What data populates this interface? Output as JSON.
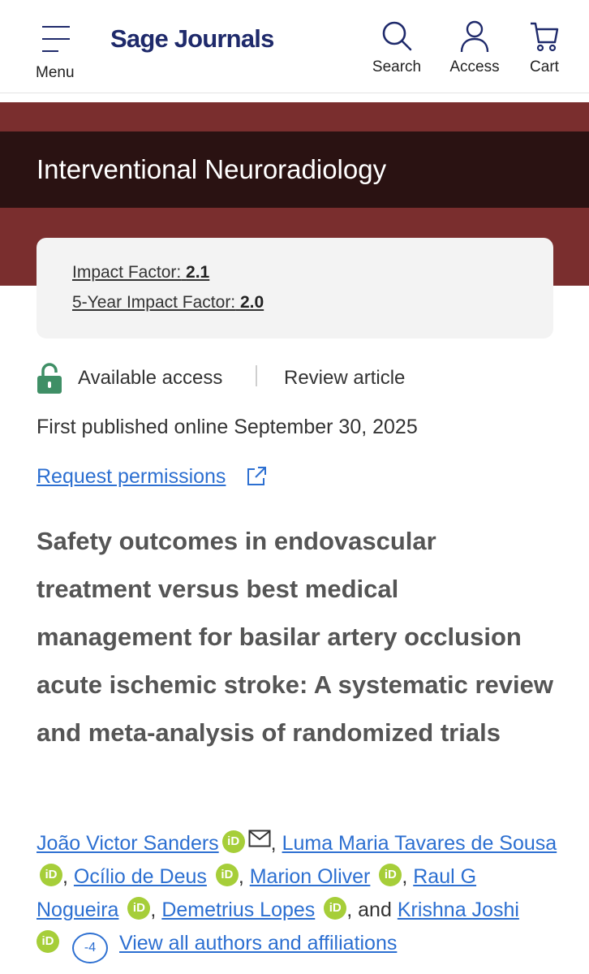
{
  "header": {
    "menu_label": "Menu",
    "logo": "Sage Journals",
    "search_label": "Search",
    "access_label": "Access",
    "cart_label": "Cart"
  },
  "journal": {
    "title": "Interventional Neuroradiology",
    "impact_factor_label": "Impact Factor:",
    "impact_factor_value": "2.1",
    "five_year_label": "5-Year Impact Factor:",
    "five_year_value": "2.0"
  },
  "article": {
    "access_type": "Available access",
    "article_type": "Review article",
    "published": "First published online September 30, 2025",
    "permissions_link": "Request permissions",
    "title": "Safety outcomes in endovascular treatment versus best medical management for basilar artery occlusion acute ischemic stroke: A systematic review and meta-analysis of randomized trials"
  },
  "authors": {
    "list": [
      "João Victor Sanders",
      "Luma Maria Tavares de Sousa",
      "Ocílio de Deus",
      "Marion Oliver",
      "Raul G Nogueira",
      "Demetrius Lopes",
      "Krishna Joshi"
    ],
    "orcid_glyph": "iD",
    "conjunction": "and",
    "hidden_count": "-4",
    "view_all_label": "View all authors and affiliations"
  },
  "colors": {
    "brand_navy": "#1f2a6b",
    "journal_maroon": "#7a2e2e",
    "journal_dark": "#2a1212",
    "link_blue": "#2c6fd1",
    "orcid_green": "#a6ce39",
    "lock_green": "#3f8f66"
  },
  "icons": [
    "menu-icon",
    "search-icon",
    "user-icon",
    "cart-icon",
    "lock-icon",
    "external-link-icon",
    "mail-icon",
    "orcid-icon"
  ]
}
